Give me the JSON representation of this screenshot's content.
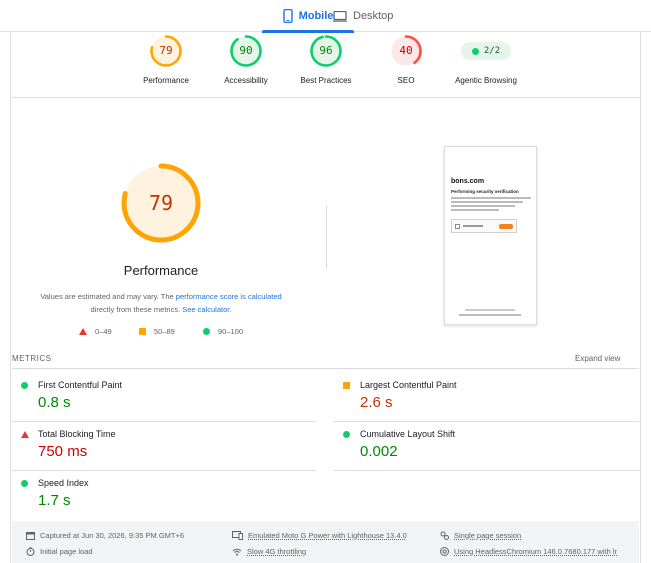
{
  "tabs": {
    "mobile": "Mobile",
    "desktop": "Desktop"
  },
  "categories": [
    {
      "score": "79",
      "label": "Performance",
      "color": "#ffa400"
    },
    {
      "score": "90",
      "label": "Accessibility",
      "color": "#0cce6b"
    },
    {
      "score": "96",
      "label": "Best Practices",
      "color": "#0cce6b"
    },
    {
      "score": "40",
      "label": "SEO",
      "color": "#ff4e42"
    },
    {
      "score": "2/2",
      "label": "Agentic Browsing",
      "color": "#0cce6b"
    }
  ],
  "performance": {
    "score": "79",
    "title": "Performance",
    "note_prefix": "Values are estimated and may vary. The ",
    "note_link": "performance score is calculated",
    "note_middle": " directly from these metrics. ",
    "note_link2": "See calculator."
  },
  "legend": {
    "poor": "0–49",
    "average": "50–89",
    "good": "90–100"
  },
  "screenshot": {
    "domain": "bons.com",
    "heading": "Performing security verification"
  },
  "metrics": {
    "header": "METRICS",
    "expand": "Expand view",
    "fcp": {
      "label": "First Contentful Paint",
      "value": "0.8 s"
    },
    "lcp": {
      "label": "Largest Contentful Paint",
      "value": "2.6 s"
    },
    "tbt": {
      "label": "Total Blocking Time",
      "value": "750 ms"
    },
    "cls": {
      "label": "Cumulative Layout Shift",
      "value": "0.002"
    },
    "si": {
      "label": "Speed Index",
      "value": "1.7 s"
    }
  },
  "footer": {
    "captured": "Captured at Jun 30, 2026, 9:35 PM GMT+6",
    "initial": "Initial page load",
    "device": "Emulated Moto G Power with Lighthouse 13.4.0",
    "throttle": "Slow 4G throttling",
    "session": "Single page session",
    "browser": "Using HeadlessChromium 146.0.7680.177 with lr"
  }
}
